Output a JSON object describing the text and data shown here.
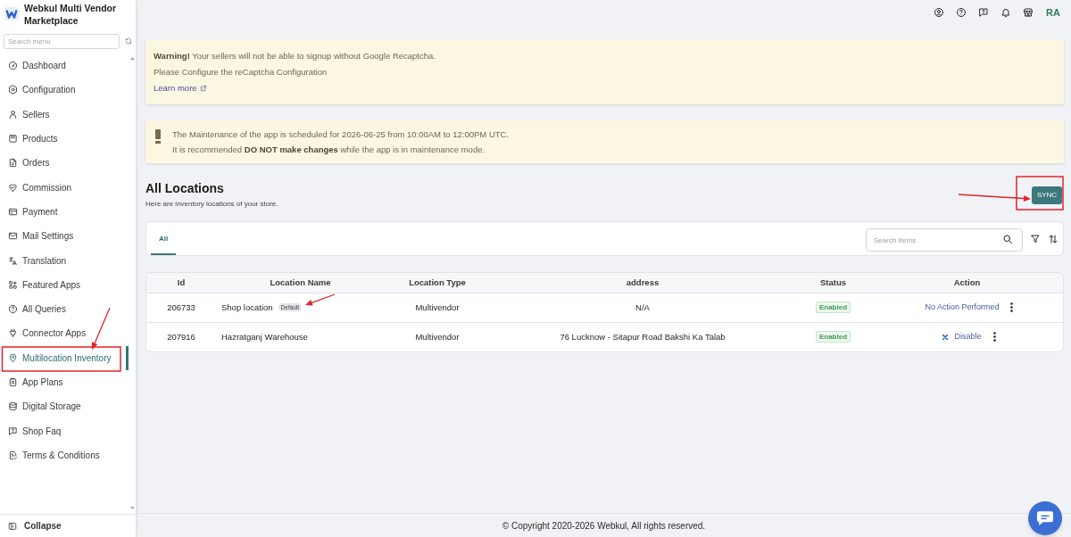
{
  "sidebar": {
    "title": "Webkul Multi Vendor Marketplace",
    "search": {
      "placeholder": "Search menu"
    },
    "items": [
      {
        "label": "Dashboard",
        "selected": false
      },
      {
        "label": "Configuration",
        "selected": false
      },
      {
        "label": "Sellers",
        "selected": false
      },
      {
        "label": "Products",
        "selected": false
      },
      {
        "label": "Orders",
        "selected": false
      },
      {
        "label": "Commission",
        "selected": false
      },
      {
        "label": "Payment",
        "selected": false
      },
      {
        "label": "Mail Settings",
        "selected": false
      },
      {
        "label": "Translation",
        "selected": false
      },
      {
        "label": "Featured Apps",
        "selected": false
      },
      {
        "label": "All Queries",
        "selected": false
      },
      {
        "label": "Connector Apps",
        "selected": false
      },
      {
        "label": "Multilocation Inventory",
        "selected": true
      },
      {
        "label": "App Plans",
        "selected": false
      },
      {
        "label": "Digital Storage",
        "selected": false
      },
      {
        "label": "Shop Faq",
        "selected": false
      },
      {
        "label": "Terms & Conditions",
        "selected": false
      }
    ],
    "collapse": "Collapse"
  },
  "topbar": {
    "avatar_initials": "RA"
  },
  "banners": [
    {
      "kind": "warning",
      "lines": [
        "**Warning!** Your sellers will not be able to signup without Google Recaptcha.",
        "Please Configure the reCaptcha Configuration"
      ],
      "link": "Learn more"
    },
    {
      "kind": "maintenance",
      "lines": [
        "The Maintenance of the app is scheduled for 2026-06-25 from 10:00AM to 12:00PM UTC.",
        "It is recommended **DO NOT make changes** while the app is in maintenance mode."
      ]
    }
  ],
  "page": {
    "title": "All Locations",
    "subtitle": "Here are inventory locations of your store.",
    "sync_button": "SYNC"
  },
  "tabs": [
    {
      "label": "All",
      "selected": true
    }
  ],
  "search": {
    "placeholder": "Search Items"
  },
  "table": {
    "columns": [
      "Id",
      "Location Name",
      "Location Type",
      "address",
      "Status",
      "Action"
    ],
    "rows": [
      {
        "id": "206733",
        "name": "Shop location",
        "badge": "Default",
        "type": "Multivendor",
        "address": "N/A",
        "status": "Enabled",
        "action": {
          "kind": "none",
          "label": "No Action Performed"
        }
      },
      {
        "id": "207916",
        "name": "Hazratganj Warehouse",
        "type": "Multivendor",
        "address": "76 Lucknow - Sitapur Road Bakshi Ka Talab",
        "status": "Enabled",
        "action": {
          "kind": "disable",
          "label": "Disable"
        }
      }
    ]
  },
  "footer": "© Copyright 2020-2026 Webkul, All rights reserved."
}
